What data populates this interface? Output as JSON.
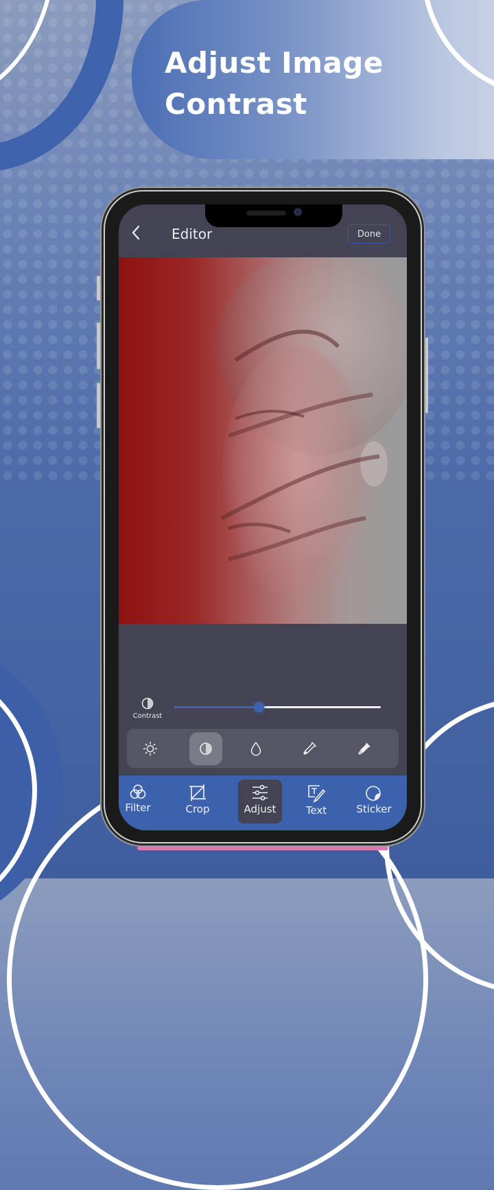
{
  "promo": {
    "headline_line1": "Adjust Image",
    "headline_line2": "Contrast"
  },
  "editor": {
    "title": "Editor",
    "back_icon": "chevron-left-icon",
    "done_label": "Done"
  },
  "adjust": {
    "active_adjustment": "Contrast",
    "slider_label": "Contrast",
    "slider_value_fraction": 0.41,
    "tools": [
      {
        "name": "brightness",
        "icon": "sun-icon",
        "active": false
      },
      {
        "name": "contrast",
        "icon": "contrast-icon",
        "active": true
      },
      {
        "name": "saturation",
        "icon": "droplet-icon",
        "active": false
      },
      {
        "name": "eyedropper",
        "icon": "eyedropper-icon",
        "active": false
      },
      {
        "name": "highlight",
        "icon": "flashlight-icon",
        "active": false
      }
    ]
  },
  "bottom_nav": [
    {
      "label": "Filter",
      "icon": "filter-circles-icon",
      "active": false
    },
    {
      "label": "Crop",
      "icon": "crop-icon",
      "active": false
    },
    {
      "label": "Adjust",
      "icon": "sliders-icon",
      "active": true
    },
    {
      "label": "Text",
      "icon": "text-edit-icon",
      "active": false
    },
    {
      "label": "Sticker",
      "icon": "sticker-icon",
      "active": false
    }
  ],
  "colors": {
    "accent": "#3f62b0",
    "nav_bar": "#3d62ad",
    "editor_bg": "#434353"
  }
}
